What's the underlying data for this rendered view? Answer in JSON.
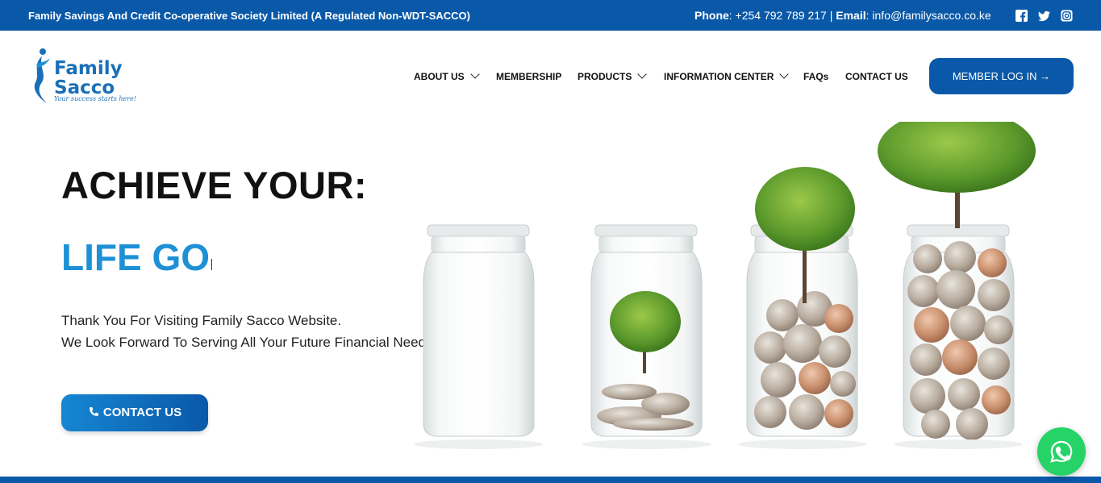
{
  "topbar": {
    "tagline": "Family Savings And Credit Co-operative Society Limited (A Regulated Non-WDT-SACCO)",
    "phone_label": "Phone",
    "phone_value": ": +254 792 789 217 | ",
    "email_label": "Email",
    "email_value": ": info@familysacco.co.ke",
    "social_icons": [
      "facebook-icon",
      "twitter-icon",
      "instagram-icon"
    ]
  },
  "logo": {
    "word1": "Family",
    "word2": "Sacco",
    "slogan": "Your success starts here!"
  },
  "nav": {
    "items": [
      {
        "label": "ABOUT US",
        "dropdown": true
      },
      {
        "label": "MEMBERSHIP",
        "dropdown": false
      },
      {
        "label": "PRODUCTS",
        "dropdown": true
      },
      {
        "label": "INFORMATION CENTER",
        "dropdown": true
      },
      {
        "label": "FAQs",
        "dropdown": false
      },
      {
        "label": "CONTACT US",
        "dropdown": false
      }
    ],
    "login_label": "MEMBER LOG IN →"
  },
  "hero": {
    "title": "ACHIEVE YOUR:",
    "typed_text": "LIFE GO",
    "line1": "Thank You For Visiting Family Sacco Website.",
    "line2": "We Look Forward To Serving All Your Future Financial Needs.",
    "cta_label": "CONTACT US"
  },
  "colors": {
    "brand_blue": "#0a59a8",
    "accent_blue": "#1e90d6",
    "whatsapp_green": "#25d366"
  }
}
